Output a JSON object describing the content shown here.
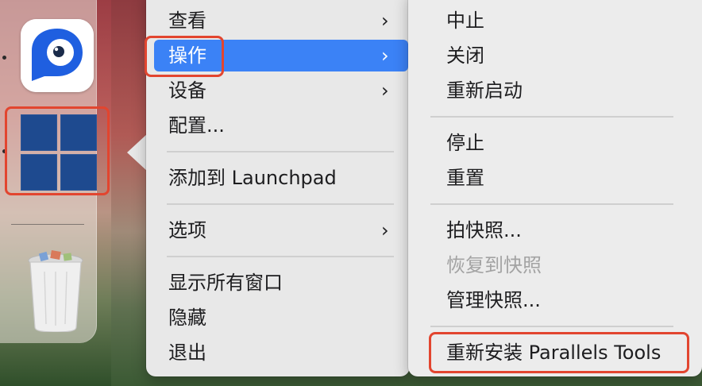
{
  "main_menu": {
    "view": "查看",
    "actions": "操作",
    "devices": "设备",
    "configure": "配置...",
    "add_to_launchpad": "添加到 Launchpad",
    "options": "选项",
    "show_all_windows": "显示所有窗口",
    "hide": "隐藏",
    "quit": "退出"
  },
  "submenu": {
    "suspend": "中止",
    "shut_down": "关闭",
    "restart": "重新启动",
    "stop": "停止",
    "reset": "重置",
    "take_snapshot": "拍快照...",
    "revert_to_snapshot": "恢复到快照",
    "manage_snapshots": "管理快照...",
    "reinstall_parallels_tools": "重新安装 Parallels Tools"
  },
  "icons": {
    "submenu_chevron": "chevron-right-icon",
    "parallels_app": "parallels-desktop-icon",
    "windows_vm": "windows-logo-icon",
    "trash": "trash-icon"
  },
  "colors": {
    "selection": "#3b82f6",
    "highlight_annotation": "#e2452f",
    "disabled_text": "#a3a3a3"
  }
}
